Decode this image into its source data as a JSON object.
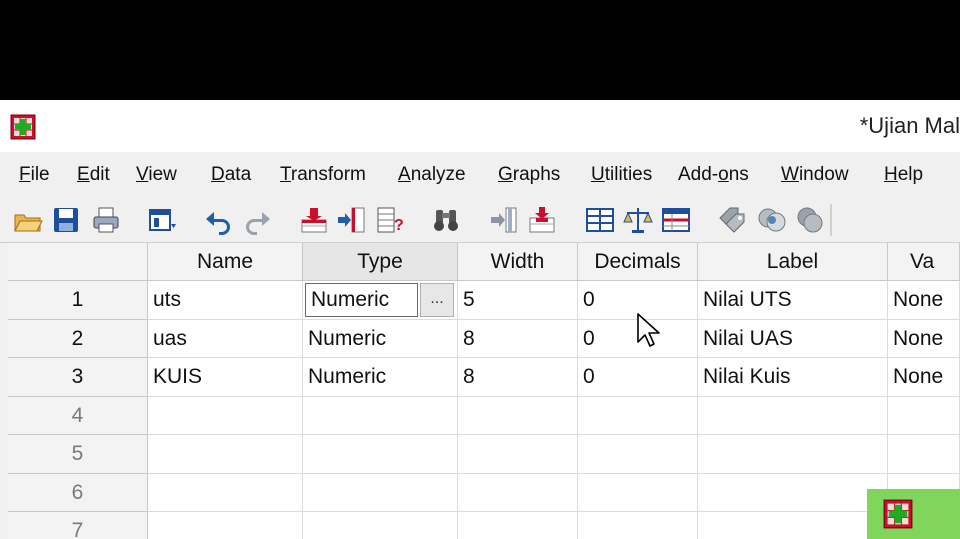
{
  "window": {
    "title": "*Ujian Mal"
  },
  "menu": [
    {
      "key": "file",
      "pre": "",
      "ul": "F",
      "post": "ile"
    },
    {
      "key": "edit",
      "pre": "",
      "ul": "E",
      "post": "dit"
    },
    {
      "key": "view",
      "pre": "",
      "ul": "V",
      "post": "iew"
    },
    {
      "key": "data",
      "pre": "",
      "ul": "D",
      "post": "ata"
    },
    {
      "key": "transform",
      "pre": "",
      "ul": "T",
      "post": "ransform"
    },
    {
      "key": "analyze",
      "pre": "",
      "ul": "A",
      "post": "nalyze"
    },
    {
      "key": "graphs",
      "pre": "",
      "ul": "G",
      "post": "raphs"
    },
    {
      "key": "utilities",
      "pre": "",
      "ul": "U",
      "post": "tilities"
    },
    {
      "key": "addons",
      "pre": "Add-",
      "ul": "o",
      "post": "ns"
    },
    {
      "key": "window",
      "pre": "",
      "ul": "W",
      "post": "indow"
    },
    {
      "key": "help",
      "pre": "",
      "ul": "H",
      "post": "elp"
    }
  ],
  "toolbar": {
    "icons": [
      "open-folder-icon",
      "save-icon",
      "print-icon",
      "dialog-recall-icon",
      "undo-icon",
      "redo-icon",
      "goto-case-icon",
      "goto-variable-icon",
      "variables-icon",
      "find-icon",
      "insert-variable-icon",
      "insert-cases-icon",
      "split-file-icon",
      "weight-cases-icon",
      "select-cases-icon",
      "value-labels-icon",
      "use-variable-sets-icon",
      "show-all-variables-icon"
    ]
  },
  "grid": {
    "columns": [
      "Name",
      "Type",
      "Width",
      "Decimals",
      "Label",
      "Va"
    ],
    "rows": [
      {
        "num": "1",
        "name": "uts",
        "type": "Numeric",
        "width": "5",
        "decimals": "0",
        "label": "Nilai UTS",
        "values": "None"
      },
      {
        "num": "2",
        "name": "uas",
        "type": "Numeric",
        "width": "8",
        "decimals": "0",
        "label": "Nilai UAS",
        "values": "None"
      },
      {
        "num": "3",
        "name": "KUIS",
        "type": "Numeric",
        "width": "8",
        "decimals": "0",
        "label": "Nilai Kuis",
        "values": "None"
      }
    ],
    "empty_rows": [
      "4",
      "5",
      "6",
      "7"
    ],
    "edit_button_label": "..."
  },
  "colors": {
    "accent": "#7fd65a",
    "icon_blue": "#1f5fa8"
  }
}
